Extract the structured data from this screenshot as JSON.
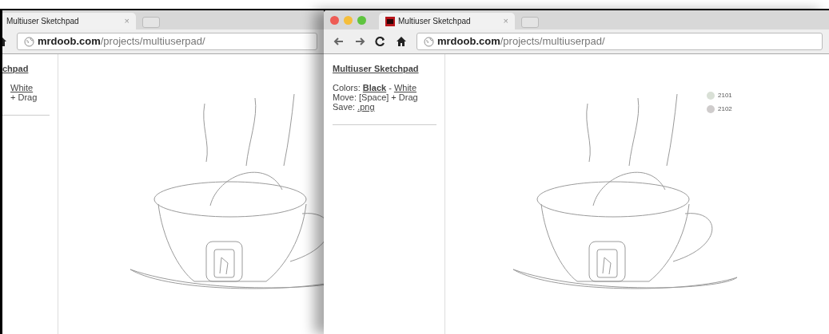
{
  "windows": [
    {
      "tab": {
        "title": "Multiuser Sketchpad",
        "close": "×"
      },
      "address": {
        "host": "mrdoob.com",
        "path": "/projects/multiuserpad/"
      },
      "sidebar": {
        "title": "chpad",
        "lines": [
          {
            "parts": [
              {
                "text": "White",
                "link": true,
                "bold": false
              }
            ]
          },
          {
            "parts": [
              {
                "text": "+ Drag",
                "link": false,
                "bold": false
              }
            ]
          }
        ]
      }
    },
    {
      "tab": {
        "title": "Multiuser Sketchpad",
        "close": "×"
      },
      "address": {
        "host": "mrdoob.com",
        "path": "/projects/multiuserpad/"
      },
      "sidebar": {
        "title": "Multiuser Sketchpad",
        "lines": [
          {
            "parts": [
              {
                "text": "Colors:",
                "link": false,
                "bold": false
              },
              {
                "text": "Black",
                "link": true,
                "bold": true
              },
              {
                "text": "-",
                "link": false,
                "bold": false
              },
              {
                "text": "White",
                "link": true,
                "bold": false
              }
            ]
          },
          {
            "parts": [
              {
                "text": "Move: [Space] + Drag",
                "link": false,
                "bold": false
              }
            ]
          },
          {
            "parts": [
              {
                "text": "Save:",
                "link": false,
                "bold": false
              },
              {
                "text": ".png",
                "link": true,
                "bold": false
              }
            ]
          }
        ]
      },
      "users": [
        {
          "name": "2101",
          "color": "#d9e0d6"
        },
        {
          "name": "2102",
          "color": "#cfcccc"
        }
      ]
    }
  ]
}
